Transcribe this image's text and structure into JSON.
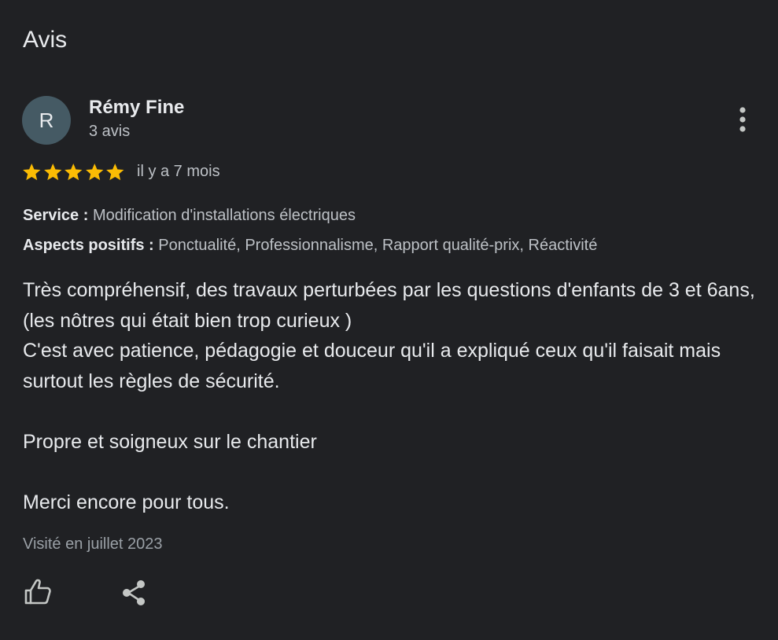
{
  "header": {
    "title": "Avis"
  },
  "review": {
    "author": {
      "initial": "R",
      "name": "Rémy Fine",
      "reviews_count": "3 avis",
      "avatar_color": "#455a64"
    },
    "rating": {
      "value": 5,
      "max": 5,
      "star_color": "#fbbc04"
    },
    "date": "il y a 7 mois",
    "service_label": "Service :",
    "service_value": "Modification d'installations électriques",
    "aspects_label": "Aspects positifs :",
    "aspects_value": "Ponctualité, Professionnalisme, Rapport qualité-prix, Réactivité",
    "text": {
      "line1": "Très compréhensif, des travaux perturbées par les questions d'enfants de 3 et 6ans, (les nôtres qui était bien trop curieux )",
      "line2": "C'est avec patience, pédagogie et douceur qu'il a expliqué ceux qu'il faisait mais surtout les règles de sécurité.",
      "line3": "Propre et soigneux sur le chantier",
      "line4": "Merci encore pour tous."
    },
    "visited": "Visité en juillet 2023"
  },
  "icons": {
    "more": "more-vert-icon",
    "like": "thumb-up-icon",
    "share": "share-icon",
    "star": "star-icon"
  }
}
